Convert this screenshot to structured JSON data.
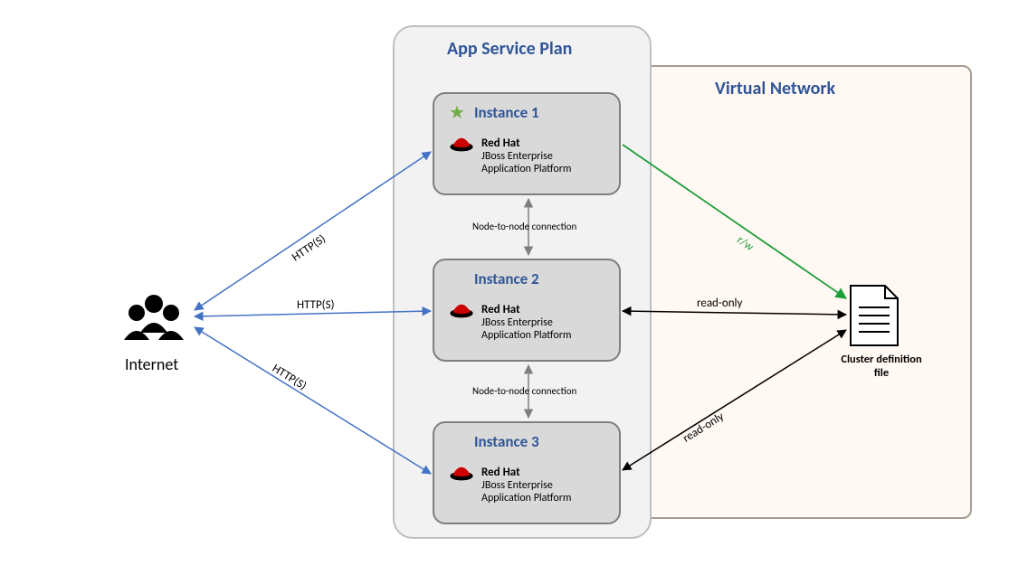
{
  "titles": {
    "app_service_plan": "App Service Plan",
    "virtual_network": "Virtual Network"
  },
  "internet": {
    "label": "Internet"
  },
  "http_labels": {
    "to_inst1": "HTTP(S)",
    "to_inst2": "HTTP(S)",
    "to_inst3": "HTTP(S)"
  },
  "instances": [
    {
      "title": "Instance 1",
      "brand": "Red Hat",
      "product_line1": "JBoss Enterprise",
      "product_line2": "Application Platform",
      "is_primary": true
    },
    {
      "title": "Instance 2",
      "brand": "Red Hat",
      "product_line1": "JBoss Enterprise",
      "product_line2": "Application Platform",
      "is_primary": false
    },
    {
      "title": "Instance 3",
      "brand": "Red Hat",
      "product_line1": "JBoss Enterprise",
      "product_line2": "Application Platform",
      "is_primary": false
    }
  ],
  "node_conn": {
    "between_1_2": "Node-to-node connection",
    "between_2_3": "Node-to-node connection"
  },
  "file_edges": {
    "inst1": "r/w",
    "inst2": "read-only",
    "inst3": "read-only"
  },
  "cluster_file": {
    "label_line1": "Cluster definition",
    "label_line2": "file"
  }
}
